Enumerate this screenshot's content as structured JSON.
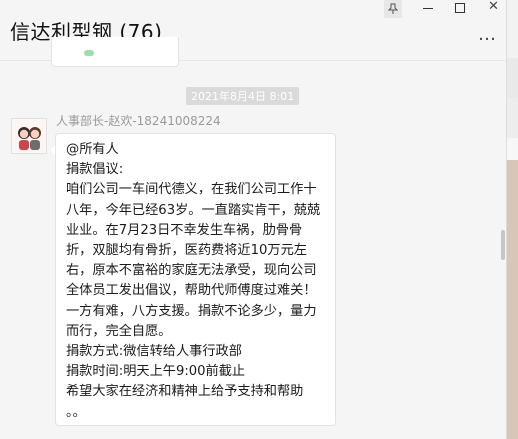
{
  "window": {
    "title": "信达利型钢 (76)",
    "more_glyph": "…"
  },
  "controls": {
    "pin": "pin-icon",
    "minimize": "minimize-icon",
    "maximize": "maximize-icon",
    "close": "close-icon"
  },
  "chat": {
    "timestamp": "2021年8月4日 8:01",
    "sender": "人事部长-赵欢-18241008224",
    "message": "@所有人\n捐款倡议:\n咱们公司一车间代德义，在我们公司工作十八年，今年已经63岁。一直踏实肯干，兢兢业业。在7月23日不幸发生车祸，肋骨骨折，双腿均有骨折，医药费将近10万元左右，原本不富裕的家庭无法承受，现向公司全体员工发出倡议，帮助代师傅度过难关！一方有难，八方支援。捐款不论多少，量力而行，完全自愿。\n捐款方式:微信转给人事行政部\n捐款时间:明天上午9:00前截止\n希望大家在经济和精神上给予支持和帮助\n。。"
  },
  "colors": {
    "background": "#f5f5f5",
    "bubble": "#ffffff",
    "time_badge": "#dadada"
  }
}
